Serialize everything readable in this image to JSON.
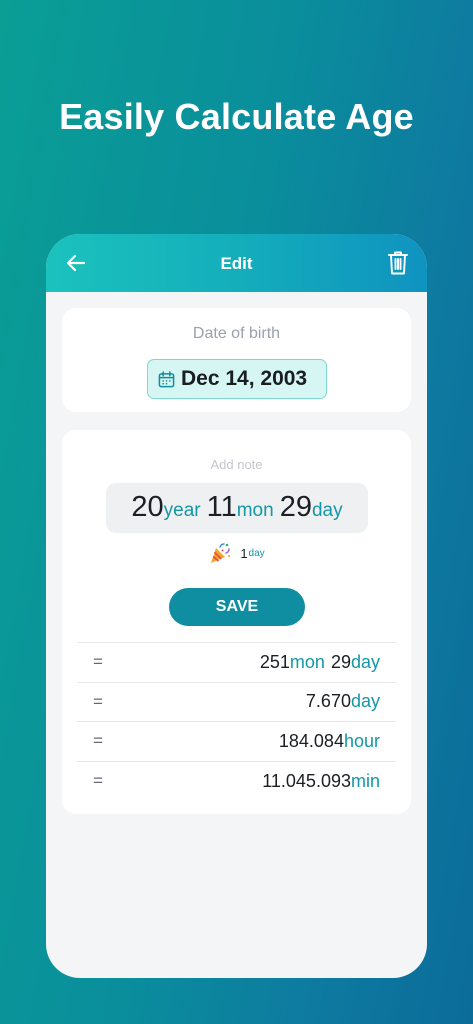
{
  "headline": "Easily Calculate Age",
  "appbar": {
    "title": "Edit",
    "back_icon": "arrow-left-icon",
    "delete_icon": "trash-icon"
  },
  "dob": {
    "label": "Date of birth",
    "value": "Dec 14, 2003",
    "icon": "calendar-icon"
  },
  "age": {
    "note_placeholder": "Add note",
    "years": "20",
    "years_unit": "year",
    "months": "11",
    "months_unit": "mon",
    "days": "29",
    "days_unit": "day",
    "countdown_value": "1",
    "countdown_unit": "day",
    "countdown_icon": "party-popper-icon",
    "save_label": "SAVE"
  },
  "results": [
    {
      "eq": "=",
      "n1": "251",
      "u1": "mon",
      "n2": "29",
      "u2": "day"
    },
    {
      "eq": "=",
      "n1": "7.670",
      "u1": "day"
    },
    {
      "eq": "=",
      "n1": "184.084",
      "u1": "hour"
    },
    {
      "eq": "=",
      "n1": "11.045.093",
      "u1": "min"
    }
  ],
  "colors": {
    "accent": "#1597a6",
    "button": "#0f8ea1",
    "chip_bg": "#d6f6f3"
  }
}
